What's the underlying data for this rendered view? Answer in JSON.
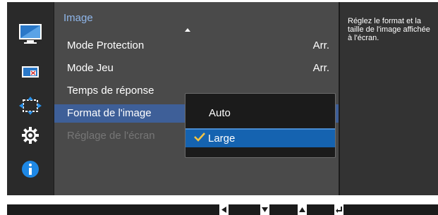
{
  "menu": {
    "title": "Image",
    "items": [
      {
        "label": "Mode Protection",
        "value": "Arr."
      },
      {
        "label": "Mode Jeu",
        "value": "Arr."
      },
      {
        "label": "Temps de réponse",
        "value": ""
      },
      {
        "label": "Format de l'image",
        "value": ""
      },
      {
        "label": "Réglage de l'écran",
        "value": ""
      }
    ],
    "selected_index": 3,
    "disabled_index": 4
  },
  "popup": {
    "options": [
      "Auto",
      "Large"
    ],
    "selected": "Large"
  },
  "help": {
    "text": "Réglez le format et la taille de l'image affichée à l'écran."
  },
  "sidebar": {
    "icons": [
      "monitor-icon",
      "picture-in-picture-icon",
      "resize-arrows-icon",
      "settings-gear-icon",
      "info-icon"
    ],
    "active_index": 0
  },
  "bottom_bar": {
    "buttons": [
      "left-arrow-icon",
      "down-arrow-icon",
      "up-arrow-icon",
      "enter-icon"
    ]
  },
  "colors": {
    "selected_row": "#3e5f98",
    "popup_selected": "#1563b0",
    "title": "#8fb6ea",
    "check": "#f5c542",
    "info": "#1e88e5"
  }
}
